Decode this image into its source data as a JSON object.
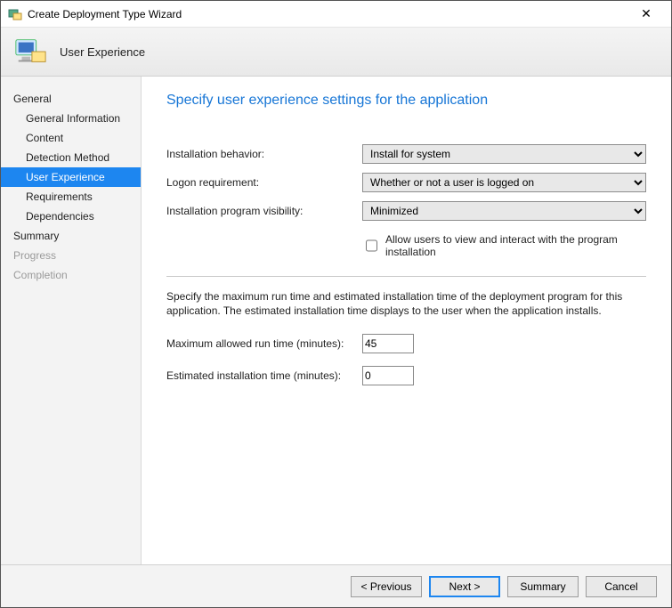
{
  "window": {
    "title": "Create Deployment Type Wizard"
  },
  "banner": {
    "step_title": "User Experience"
  },
  "sidebar": {
    "groups": [
      {
        "label": "General",
        "kind": "group"
      },
      {
        "label": "General Information",
        "kind": "item"
      },
      {
        "label": "Content",
        "kind": "item"
      },
      {
        "label": "Detection Method",
        "kind": "item"
      },
      {
        "label": "User Experience",
        "kind": "item",
        "selected": true
      },
      {
        "label": "Requirements",
        "kind": "item"
      },
      {
        "label": "Dependencies",
        "kind": "item"
      },
      {
        "label": "Summary",
        "kind": "group"
      },
      {
        "label": "Progress",
        "kind": "group",
        "disabled": true
      },
      {
        "label": "Completion",
        "kind": "group",
        "disabled": true
      }
    ]
  },
  "main": {
    "heading": "Specify user experience settings for the application",
    "fields": {
      "install_behavior_label": "Installation behavior:",
      "install_behavior_value": "Install for system",
      "logon_req_label": "Logon requirement:",
      "logon_req_value": "Whether or not a user is logged on",
      "visibility_label": "Installation program visibility:",
      "visibility_value": "Minimized",
      "allow_interact_label": "Allow users to view and interact with the program installation",
      "allow_interact_checked": false
    },
    "desc": "Specify the maximum run time and estimated installation time of the deployment program for this application. The estimated installation time displays to the user when the application installs.",
    "max_runtime_label": "Maximum allowed run time (minutes):",
    "max_runtime_value": "45",
    "est_time_label": "Estimated installation time (minutes):",
    "est_time_value": "0"
  },
  "footer": {
    "previous": "< Previous",
    "next": "Next >",
    "summary": "Summary",
    "cancel": "Cancel"
  }
}
